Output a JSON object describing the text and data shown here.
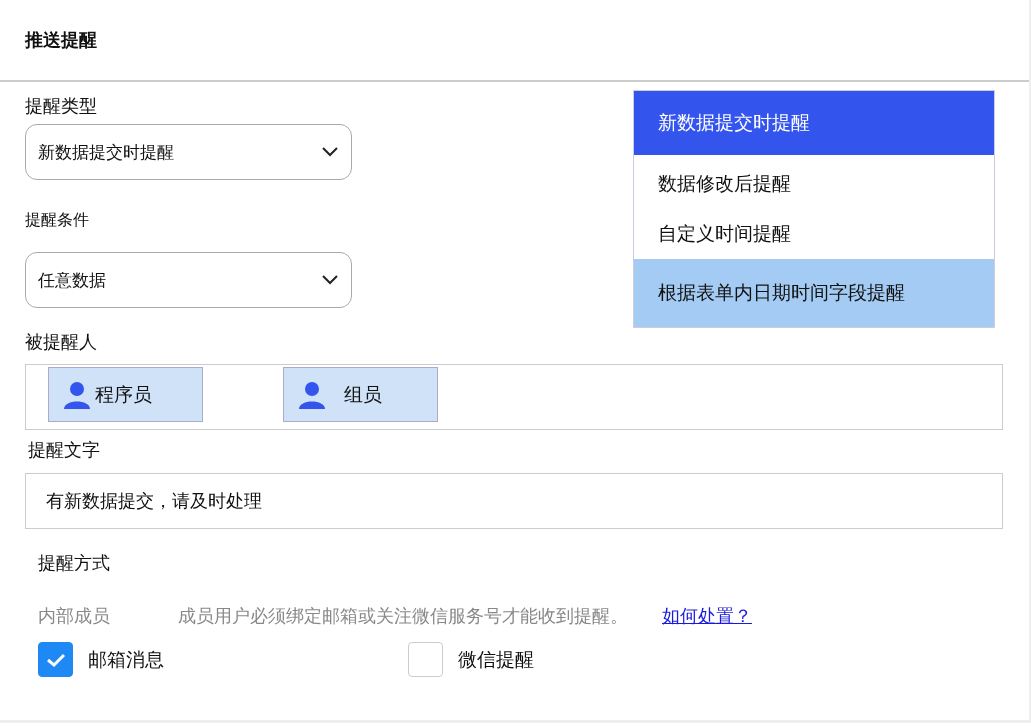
{
  "header": {
    "title": "推送提醒"
  },
  "reminder_type": {
    "label": "提醒类型",
    "value": "新数据提交时提醒",
    "expanded": true,
    "options": [
      {
        "label": "新数据提交时提醒",
        "selected": true,
        "hovered": false
      },
      {
        "label": "数据修改后提醒",
        "selected": false,
        "hovered": false
      },
      {
        "label": "自定义时间提醒",
        "selected": false,
        "hovered": false
      },
      {
        "label": "根据表单内日期时间字段提醒",
        "selected": false,
        "hovered": true
      }
    ]
  },
  "reminder_condition": {
    "label": "提醒条件",
    "value": "任意数据"
  },
  "recipients": {
    "label": "被提醒人",
    "items": [
      {
        "name": "程序员"
      },
      {
        "name": "组员"
      }
    ]
  },
  "reminder_text": {
    "label": "提醒文字",
    "value": "有新数据提交，请及时处理"
  },
  "reminder_method": {
    "label": "提醒方式",
    "group_label": "内部成员",
    "note": "成员用户必须绑定邮箱或关注微信服务号才能收到提醒。",
    "help_link": "如何处置？",
    "options": [
      {
        "label": "邮箱消息",
        "checked": true
      },
      {
        "label": "微信提醒",
        "checked": false
      }
    ]
  }
}
